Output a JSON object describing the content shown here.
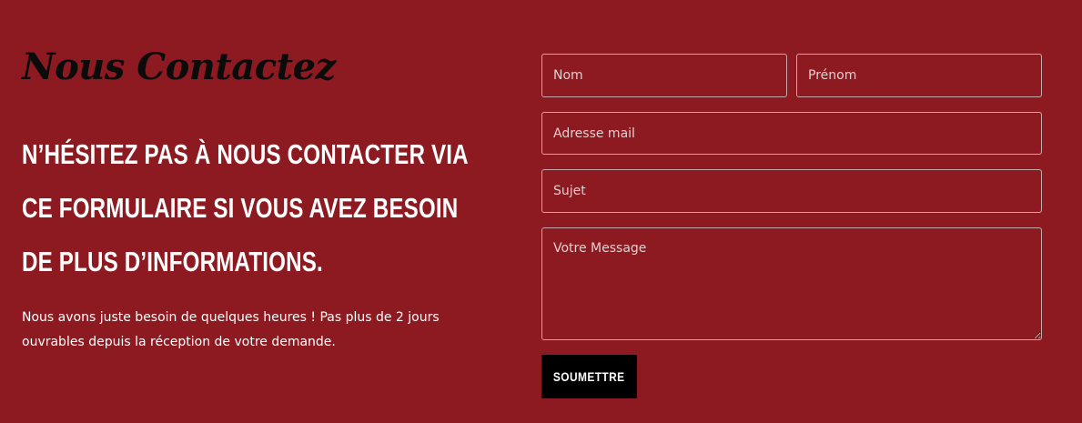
{
  "contact": {
    "title": "Nous Contactez",
    "headline": "N’hésitez pas à nous contacter via ce formulaire si vous avez besoin de plus d’informations.",
    "body": "Nous avons juste besoin de quelques heures ! Pas plus de 2 jours ouvrables depuis la réception de votre demande."
  },
  "form": {
    "nom_placeholder": "Nom",
    "prenom_placeholder": "Prénom",
    "email_placeholder": "Adresse mail",
    "subject_placeholder": "Sujet",
    "message_placeholder": "Votre Message",
    "submit_label": "SOUMETTRE"
  },
  "colors": {
    "background": "#8c1a20",
    "title": "#0b0b0b",
    "button": "#000000",
    "text": "#ffffff"
  }
}
